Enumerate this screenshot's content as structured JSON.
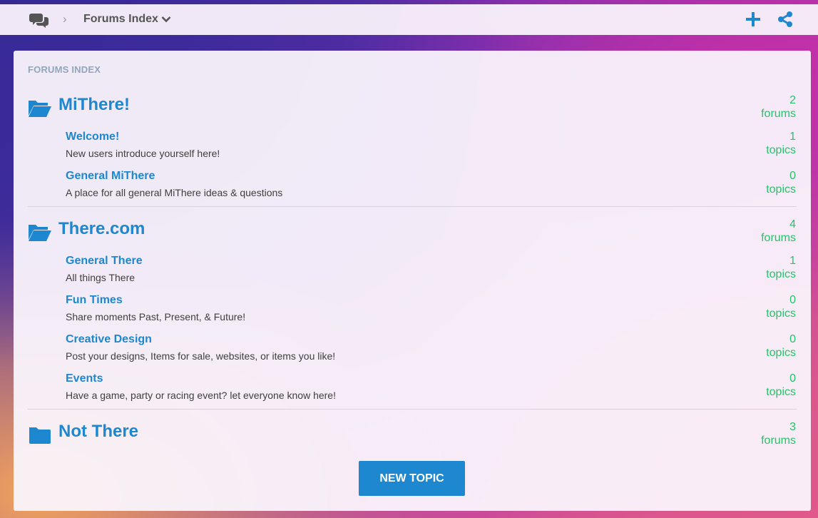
{
  "topbar": {
    "breadcrumb_label": "Forums Index",
    "icons": [
      "chat-bubbles-icon",
      "chevron-right-icon",
      "chevron-down-icon",
      "plus-icon",
      "share-icon"
    ]
  },
  "panel": {
    "title": "FORUMS INDEX"
  },
  "categories": [
    {
      "name": "MiThere!",
      "count": "2",
      "count_unit": "forums",
      "icon": "folder-open-icon",
      "forums": [
        {
          "name": "Welcome!",
          "description": "New users introduce yourself here!",
          "count": "1",
          "count_unit": "topics"
        },
        {
          "name": "General MiThere",
          "description": "A place for all general MiThere ideas & questions",
          "count": "0",
          "count_unit": "topics"
        }
      ]
    },
    {
      "name": "There.com",
      "count": "4",
      "count_unit": "forums",
      "icon": "folder-open-icon",
      "forums": [
        {
          "name": "General There",
          "description": "All things There",
          "count": "1",
          "count_unit": "topics"
        },
        {
          "name": "Fun Times",
          "description": "Share moments Past, Present, & Future!",
          "count": "0",
          "count_unit": "topics"
        },
        {
          "name": "Creative Design",
          "description": "Post your designs, Items for sale, websites, or items you like!",
          "count": "0",
          "count_unit": "topics"
        },
        {
          "name": "Events",
          "description": "Have a game, party or racing event? let everyone know here!",
          "count": "0",
          "count_unit": "topics"
        }
      ]
    },
    {
      "name": "Not There",
      "count": "3",
      "count_unit": "forums",
      "icon": "folder-closed-icon",
      "forums": []
    }
  ],
  "actions": {
    "new_topic_label": "NEW TOPIC"
  },
  "colors": {
    "accent": "#1d87cf",
    "count_green": "#27c26a",
    "panel_title": "#8fa7bb"
  }
}
